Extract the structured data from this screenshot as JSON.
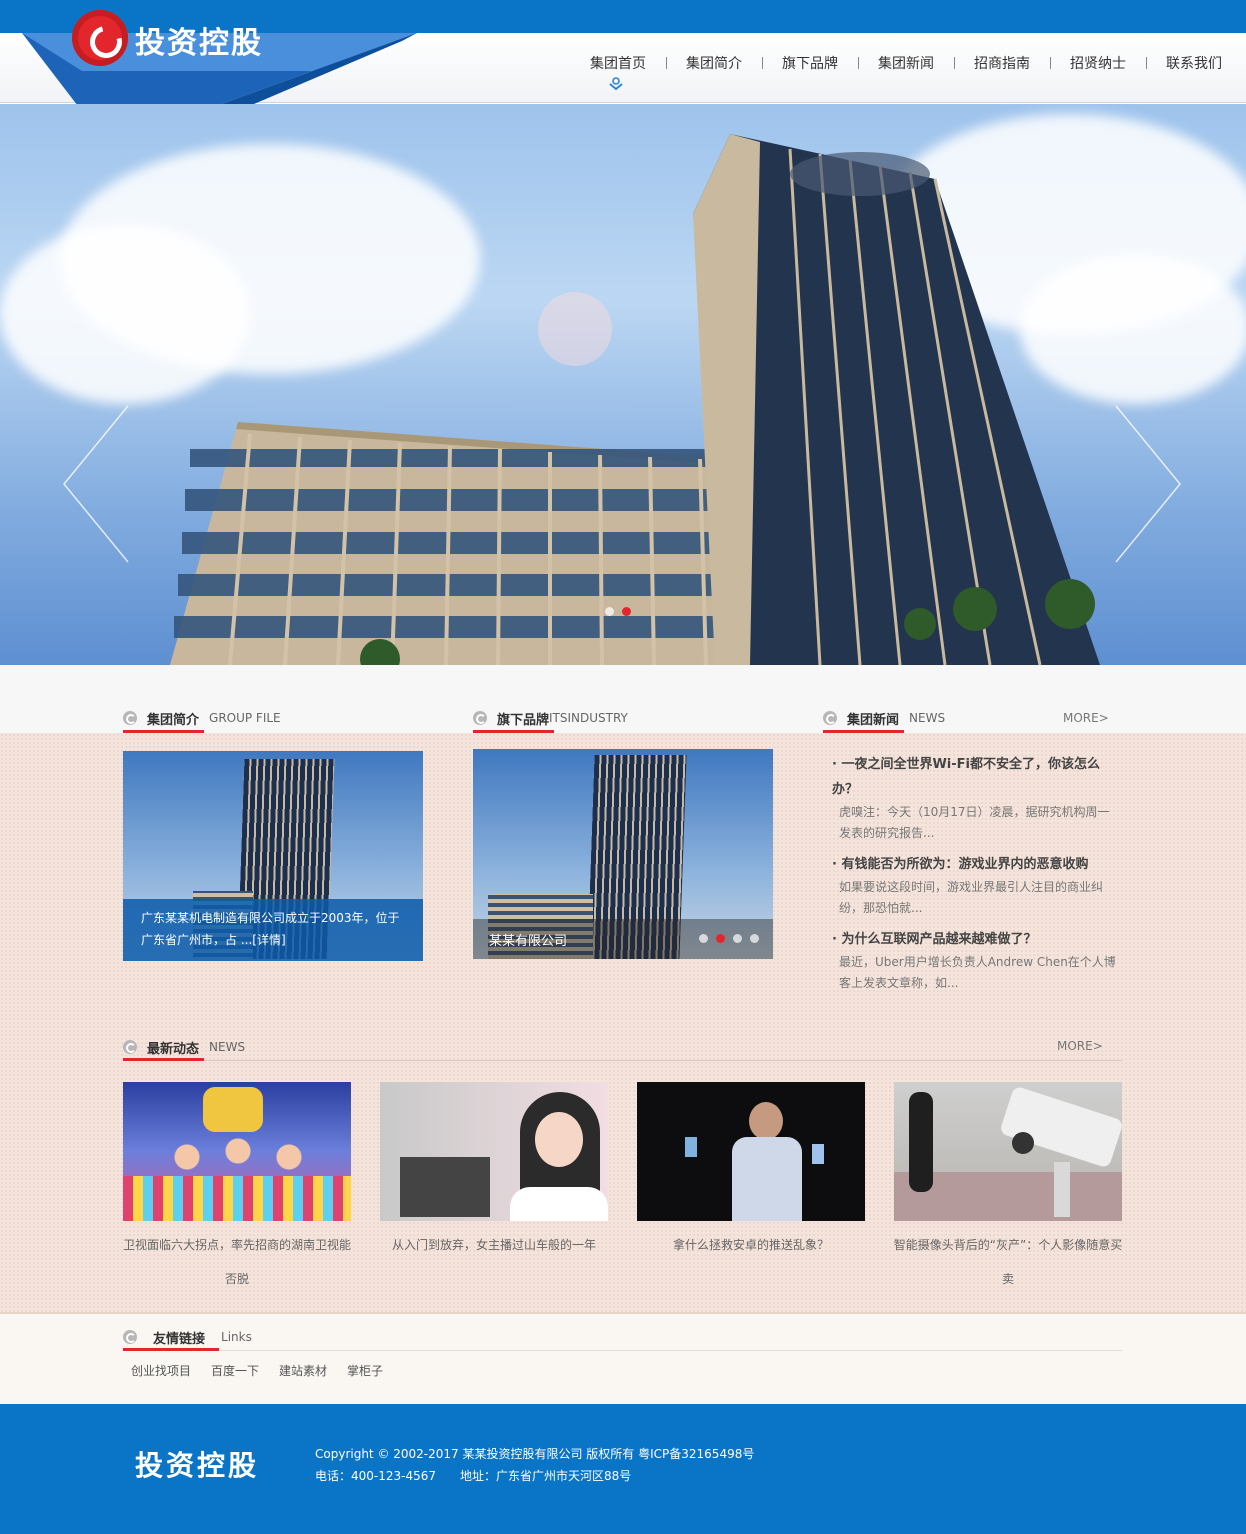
{
  "brand": {
    "name": "投资控股"
  },
  "nav": {
    "items": [
      "集团首页",
      "集团简介",
      "旗下品牌",
      "集团新闻",
      "招商指南",
      "招贤纳士",
      "联系我们"
    ]
  },
  "banner": {
    "slide_count": 2,
    "active_slide": 2
  },
  "sections": {
    "intro": {
      "title": "集团简介",
      "subtitle": "GROUP FILE",
      "caption": "广东某某机电制造有限公司成立于2003年，位于广东省广州市，占 ...[详情]"
    },
    "brands": {
      "title": "旗下品牌",
      "subtitle": "ITSINDUSTRY",
      "caption": "某某有限公司",
      "slide_count": 4,
      "active_slide": 2
    },
    "group_news": {
      "title": "集团新闻",
      "subtitle": "NEWS",
      "more": "MORE>",
      "items": [
        {
          "title": "一夜之间全世界Wi-Fi都不安全了，你该怎么办？",
          "summary": "虎嗅注：今天（10月17日）凌晨，据研究机构周一发表的研究报告..."
        },
        {
          "title": "有钱能否为所欲为：游戏业界内的恶意收购",
          "summary": "如果要说这段时间，游戏业界最引人注目的商业纠纷，那恐怕就..."
        },
        {
          "title": "为什么互联网产品越来越难做了？",
          "summary": "最近，Uber用户增长负责人Andrew Chen在个人博客上发表文章称，如..."
        }
      ]
    },
    "latest": {
      "title": "最新动态",
      "subtitle": "NEWS",
      "more": "MORE>",
      "items": [
        {
          "caption": "卫视面临六大拐点，率先招商的湖南卫视能否脱"
        },
        {
          "caption": "从入门到放弃，女主播过山车般的一年"
        },
        {
          "caption": "拿什么拯救安卓的推送乱象？"
        },
        {
          "caption": "智能摄像头背后的“灰产”：个人影像随意买卖"
        }
      ]
    },
    "links": {
      "title": "友情链接",
      "subtitle": "Links",
      "items": [
        "创业找项目",
        "百度一下",
        "建站素材",
        "掌柜子"
      ]
    }
  },
  "footer": {
    "logo": "投资控股",
    "copyright": "Copyright © 2002-2017 某某投资控股有限公司 版权所有 粤ICP备32165498号",
    "contact": "电话：400-123-4567　　地址：广东省广州市天河区88号"
  },
  "colors": {
    "brand_blue": "#0a74c7",
    "accent_red": "#e3262b"
  }
}
